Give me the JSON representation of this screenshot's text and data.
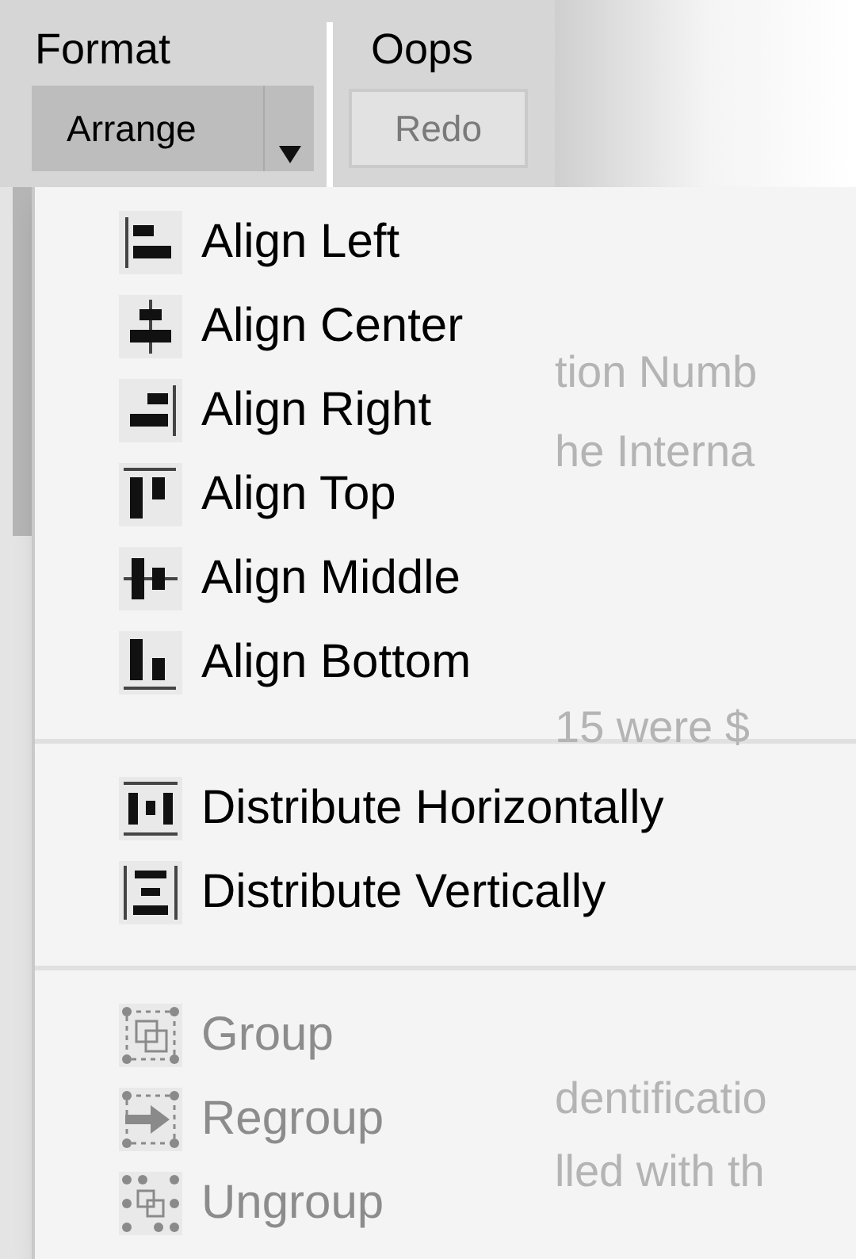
{
  "toolbar": {
    "groups": [
      {
        "label": "Format",
        "button": {
          "label": "Arrange",
          "kind": "split",
          "open": true,
          "disabled": false
        }
      },
      {
        "label": "Oops",
        "button": {
          "label": "Redo",
          "kind": "plain",
          "open": false,
          "disabled": true
        }
      }
    ]
  },
  "background_text": [
    "tion Numb",
    "he Interna",
    "15 were $",
    "dentificatio",
    "lled with th"
  ],
  "menu": {
    "sections": [
      {
        "items": [
          {
            "label": "Align Left",
            "kind": "align-left",
            "disabled": false
          },
          {
            "label": "Align Center",
            "kind": "align-center",
            "disabled": false
          },
          {
            "label": "Align Right",
            "kind": "align-right",
            "disabled": false
          },
          {
            "label": "Align Top",
            "kind": "align-top",
            "disabled": false
          },
          {
            "label": "Align Middle",
            "kind": "align-middle",
            "disabled": false
          },
          {
            "label": "Align Bottom",
            "kind": "align-bottom",
            "disabled": false
          }
        ]
      },
      {
        "items": [
          {
            "label": "Distribute Horizontally",
            "kind": "distribute-horizontal",
            "disabled": false
          },
          {
            "label": "Distribute Vertically",
            "kind": "distribute-vertical",
            "disabled": false
          }
        ]
      },
      {
        "items": [
          {
            "label": "Group",
            "kind": "group",
            "disabled": true
          },
          {
            "label": "Regroup",
            "kind": "regroup",
            "disabled": true
          },
          {
            "label": "Ungroup",
            "kind": "ungroup",
            "disabled": true
          }
        ]
      }
    ]
  }
}
